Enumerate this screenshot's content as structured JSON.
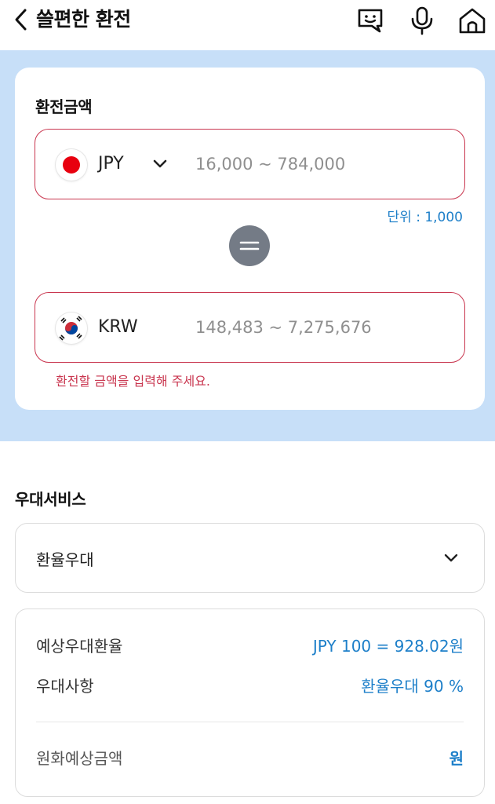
{
  "header": {
    "title": "쓸편한 환전",
    "icons": [
      "back-chevron",
      "chatbot-face",
      "microphone",
      "home"
    ]
  },
  "exchange": {
    "title": "환전금액",
    "from": {
      "currency": "JPY",
      "flag": "japan-flag",
      "placeholder": "16,000 ~ 784,000"
    },
    "unit_note": "단위 : 1,000",
    "to": {
      "currency": "KRW",
      "flag": "korea-flag",
      "placeholder": "148,483 ~ 7,275,676"
    },
    "error_message": "환전할 금액을 입력해 주세요."
  },
  "benefit": {
    "section_title": "우대서비스",
    "selected_option": "환율우대",
    "rows": [
      {
        "label": "예상우대환율",
        "value": "JPY 100 = 928.02원"
      },
      {
        "label": "우대사항",
        "value": "환율우대 90 %"
      }
    ],
    "krw_estimate": {
      "label": "원화예상금액",
      "value": "원"
    }
  },
  "colors": {
    "accent_blue": "#1d7fc9",
    "error_red": "#c9364f",
    "section_bg": "#c7dff8",
    "equal_circle": "#747b86"
  }
}
